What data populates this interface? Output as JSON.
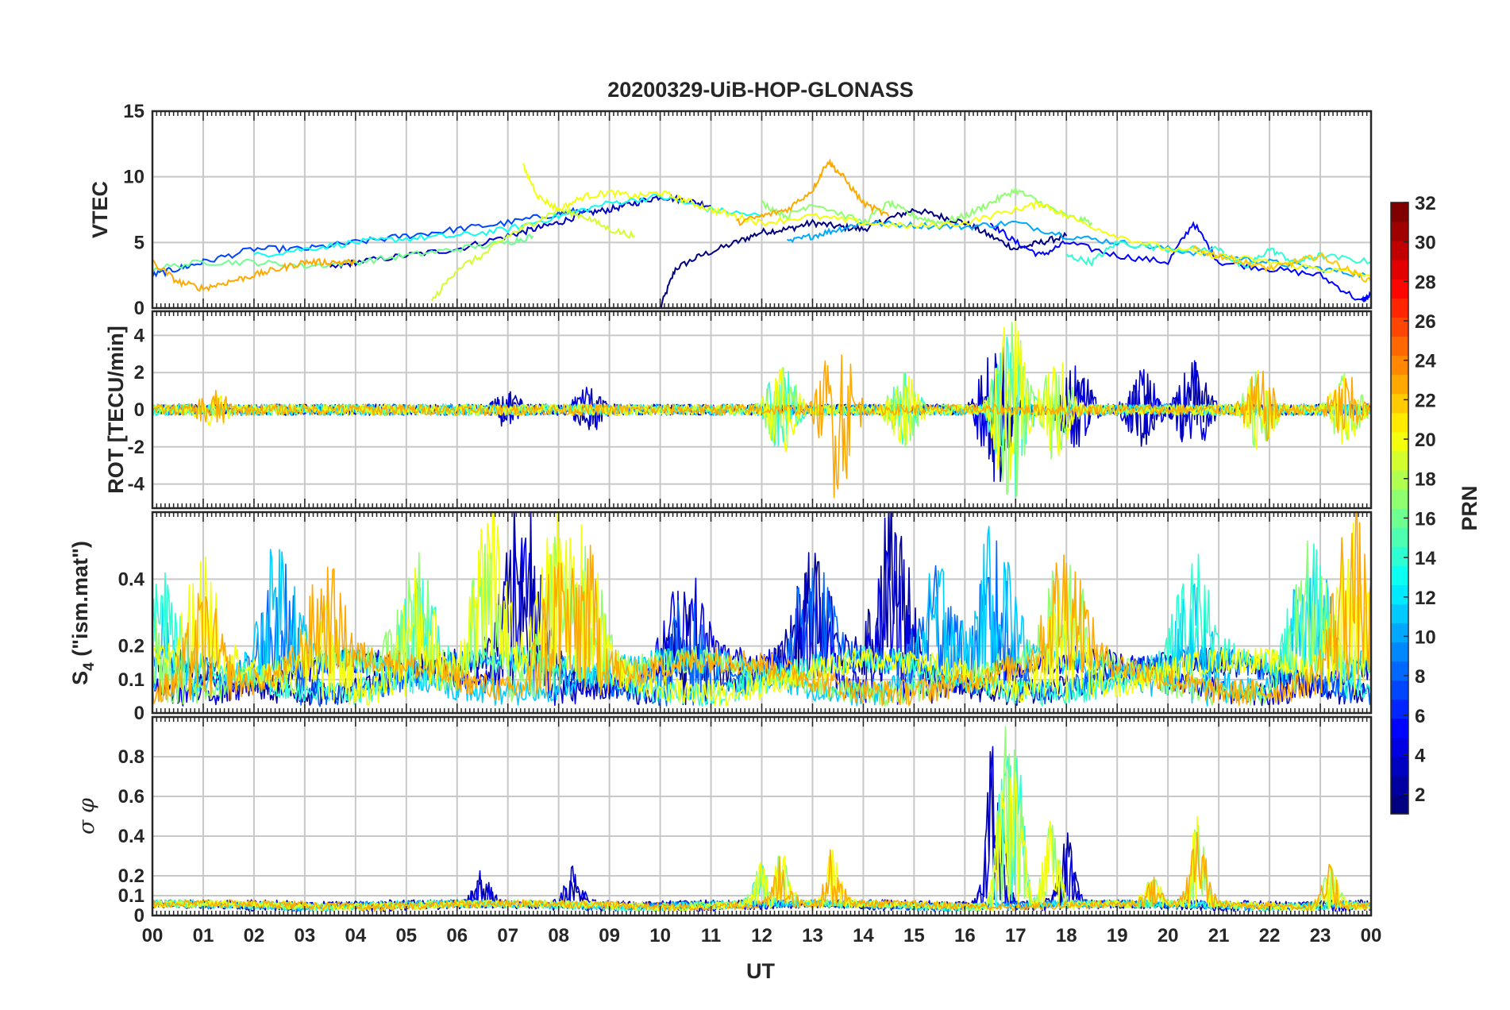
{
  "chart_data": {
    "type": "line",
    "title": "20200329-UiB-HOP-GLONASS",
    "xlabel": "UT",
    "x_ticks": [
      "00",
      "01",
      "02",
      "03",
      "04",
      "05",
      "06",
      "07",
      "08",
      "09",
      "10",
      "11",
      "12",
      "13",
      "14",
      "15",
      "16",
      "17",
      "18",
      "19",
      "20",
      "21",
      "22",
      "23",
      "00"
    ],
    "xlim_hours": [
      0,
      24
    ],
    "grid": true,
    "colorbar": {
      "label": "PRN",
      "range": [
        1,
        32
      ],
      "ticks": [
        "2",
        "4",
        "6",
        "8",
        "10",
        "12",
        "14",
        "16",
        "18",
        "20",
        "22",
        "24",
        "26",
        "28",
        "30",
        "32"
      ],
      "colormap": "jet"
    },
    "panels": [
      {
        "id": "vtec",
        "ylabel": "VTEC",
        "ylim": [
          0,
          15
        ],
        "y_ticks": [
          "0",
          "5",
          "10",
          "15"
        ],
        "series": [
          {
            "prn": 1,
            "x": [
              10.0,
              10.3,
              10.8,
              11.5,
              12.0,
              12.5,
              13.0,
              13.5,
              14.0,
              14.5,
              15.0,
              15.5,
              16.0,
              16.5,
              17.0,
              17.5,
              18.0
            ],
            "y": [
              0,
              3,
              4,
              5,
              5.8,
              6,
              6.5,
              6.2,
              6,
              6.8,
              7.5,
              7,
              6.5,
              5.5,
              4.5,
              5,
              5.5
            ]
          },
          {
            "prn": 3,
            "x": [
              3.5,
              4.0,
              5.0,
              6.0,
              7.0,
              7.5,
              8.0,
              8.5,
              9.0,
              9.5,
              10.0,
              10.5,
              11.0
            ],
            "y": [
              3,
              3.5,
              4,
              4.5,
              5.5,
              6,
              6.5,
              7.2,
              7.5,
              8,
              8.5,
              8.2,
              7.8
            ]
          },
          {
            "prn": 5,
            "x": [
              16.5,
              17.0,
              17.5,
              18.0,
              19.0,
              20.0,
              20.5,
              21.0,
              22.0,
              23.0,
              23.8,
              24.0
            ],
            "y": [
              6.5,
              5,
              4,
              5,
              4,
              3.5,
              6.5,
              3.5,
              3,
              2.5,
              0.5,
              1
            ]
          },
          {
            "prn": 7,
            "x": [
              0,
              0.5,
              1.0,
              2.0,
              3.0,
              4.0,
              5.0,
              6.0,
              7.0,
              8.0,
              8.5
            ],
            "y": [
              2.5,
              3,
              3.5,
              4.5,
              4.5,
              5,
              5.5,
              6,
              6.5,
              7.2,
              7.5
            ]
          },
          {
            "prn": 10,
            "x": [
              12.5,
              13.0,
              13.5,
              14.0,
              15.0,
              16.0,
              17.0,
              18.0,
              19.0,
              20.0,
              21.0,
              22.0,
              23.0,
              23.9
            ],
            "y": [
              5,
              5.5,
              6,
              6.5,
              6.3,
              6.2,
              6.5,
              5.5,
              5,
              4.5,
              4,
              3.5,
              3,
              2.5
            ]
          },
          {
            "prn": 13,
            "x": [
              2.0,
              3.0,
              4.0,
              5.0,
              6.0,
              7.0,
              8.0,
              9.0,
              10.0,
              11.0,
              12.0
            ],
            "y": [
              4,
              4.5,
              5,
              5.3,
              5.5,
              6,
              7,
              8,
              8.5,
              7.5,
              7
            ]
          },
          {
            "prn": 14,
            "x": [
              18.0,
              18.5,
              19.0,
              20.0,
              21.0,
              21.5,
              22.0,
              22.5,
              23.0,
              24.0
            ],
            "y": [
              4,
              3.5,
              5,
              4.5,
              4.5,
              3,
              4.5,
              3.5,
              4,
              3.5
            ]
          },
          {
            "prn": 16,
            "x": [
              0,
              1.0,
              2.0,
              3.0,
              4.0,
              5.0,
              6.0,
              7.0,
              7.5
            ],
            "y": [
              3,
              3.5,
              3.5,
              3.2,
              3.5,
              4,
              4.5,
              5,
              5.5
            ]
          },
          {
            "prn": 17,
            "x": [
              12.0,
              12.5,
              13.0,
              14.0,
              14.5,
              15.0,
              15.5,
              16.0,
              16.5,
              17.0,
              17.5,
              18.0,
              18.5
            ],
            "y": [
              8,
              7,
              8,
              6.5,
              8,
              7,
              6.5,
              7,
              8,
              9,
              8,
              7,
              6.5
            ]
          },
          {
            "prn": 19,
            "x": [
              5.5,
              6.0,
              6.5,
              7.0,
              7.5,
              8.0,
              8.5,
              9.0,
              9.5
            ],
            "y": [
              0.5,
              3,
              4,
              5.5,
              6.5,
              7.5,
              7,
              6,
              5.5
            ]
          },
          {
            "prn": 20,
            "x": [
              7.3,
              7.6,
              8.0,
              8.5,
              9.0,
              9.5,
              10.0,
              10.5,
              11.0,
              11.5,
              12.0,
              13.0,
              14.0,
              15.0,
              16.0,
              17.0,
              17.5,
              18.0,
              19.0,
              20.0,
              21.0,
              22.0,
              23.0,
              24.0
            ],
            "y": [
              10.8,
              8.5,
              7.5,
              8.5,
              8.8,
              8.5,
              8.8,
              8.2,
              7.5,
              7,
              6.5,
              7,
              6.5,
              6.2,
              6.5,
              7.5,
              8,
              7,
              5.5,
              4.5,
              4,
              3.5,
              3,
              2.5
            ]
          },
          {
            "prn": 23,
            "x": [
              0,
              0.5,
              1.0,
              1.5,
              2.0,
              2.5,
              3.0,
              3.5,
              4.0
            ],
            "y": [
              3.5,
              2,
              1.5,
              2,
              2.5,
              3,
              3.5,
              3.5,
              3.5
            ]
          },
          {
            "prn": 23,
            "x": [
              11.5,
              12.0,
              12.5,
              13.0,
              13.3,
              13.6,
              14.0,
              14.5
            ],
            "y": [
              6.5,
              7,
              7.5,
              9,
              11.2,
              10,
              8,
              7
            ]
          },
          {
            "prn": 22,
            "x": [
              20.5,
              21.0,
              21.5,
              22.0,
              22.5,
              23.0,
              23.5,
              24.0
            ],
            "y": [
              4.5,
              4,
              3.5,
              3,
              3.5,
              4,
              3,
              2
            ]
          }
        ]
      },
      {
        "id": "rot",
        "ylabel": "ROT [TECU/min]",
        "ylim": [
          -5.3,
          5.3
        ],
        "y_ticks": [
          "-4",
          "-2",
          "0",
          "2",
          "4"
        ],
        "peaks": [
          {
            "x": 1.2,
            "amp": 1.2,
            "prn": 23
          },
          {
            "x": 7.0,
            "amp": 1.0,
            "prn": 3
          },
          {
            "x": 8.6,
            "amp": 1.3,
            "prn": 2
          },
          {
            "x": 12.4,
            "amp": 2.5,
            "prn": 17
          },
          {
            "x": 13.5,
            "amp": 5.0,
            "prn": 24
          },
          {
            "x": 14.8,
            "amp": 2.0,
            "prn": 17
          },
          {
            "x": 16.6,
            "amp": 4.3,
            "prn": 2
          },
          {
            "x": 16.9,
            "amp": 5.3,
            "prn": 17
          },
          {
            "x": 17.8,
            "amp": 3.0,
            "prn": 18
          },
          {
            "x": 18.2,
            "amp": 2.5,
            "prn": 3
          },
          {
            "x": 19.5,
            "amp": 2.2,
            "prn": 3
          },
          {
            "x": 20.5,
            "amp": 2.7,
            "prn": 3
          },
          {
            "x": 21.8,
            "amp": 2.2,
            "prn": 20
          },
          {
            "x": 23.5,
            "amp": 2.0,
            "prn": 20
          }
        ]
      },
      {
        "id": "s4",
        "ylabel": "S4 (\"ism.mat\")",
        "ylabel_main": "S",
        "ylabel_sub": "4",
        "ylabel_rest": " (\"ism.mat\")",
        "ylim": [
          0,
          0.6
        ],
        "y_ticks": [
          "0",
          "0.1",
          "0.2",
          "0.4"
        ],
        "peaks": [
          {
            "x": 0.1,
            "amp": 0.35,
            "prn": 14
          },
          {
            "x": 1.0,
            "amp": 0.38,
            "prn": 23
          },
          {
            "x": 2.5,
            "amp": 0.47,
            "prn": 8
          },
          {
            "x": 3.4,
            "amp": 0.38,
            "prn": 23
          },
          {
            "x": 5.2,
            "amp": 0.42,
            "prn": 17
          },
          {
            "x": 6.6,
            "amp": 0.55,
            "prn": 19
          },
          {
            "x": 7.3,
            "amp": 0.6,
            "prn": 2
          },
          {
            "x": 8.0,
            "amp": 0.55,
            "prn": 20
          },
          {
            "x": 8.5,
            "amp": 0.52,
            "prn": 20
          },
          {
            "x": 10.5,
            "amp": 0.37,
            "prn": 5
          },
          {
            "x": 13.0,
            "amp": 0.4,
            "prn": 5
          },
          {
            "x": 14.6,
            "amp": 0.6,
            "prn": 4
          },
          {
            "x": 15.5,
            "amp": 0.45,
            "prn": 8
          },
          {
            "x": 16.6,
            "amp": 0.52,
            "prn": 10
          },
          {
            "x": 18.0,
            "amp": 0.45,
            "prn": 20
          },
          {
            "x": 20.5,
            "amp": 0.4,
            "prn": 13
          },
          {
            "x": 22.8,
            "amp": 0.5,
            "prn": 14
          },
          {
            "x": 23.6,
            "amp": 0.58,
            "prn": 23
          }
        ]
      },
      {
        "id": "sigma_phi",
        "ylabel": "σ φ",
        "ylim": [
          0,
          1.0
        ],
        "y_ticks": [
          "0",
          "0.1",
          "0.2",
          "0.4",
          "0.6",
          "0.8"
        ],
        "peaks": [
          {
            "x": 6.5,
            "amp": 0.18,
            "prn": 2
          },
          {
            "x": 8.3,
            "amp": 0.19,
            "prn": 3
          },
          {
            "x": 12.0,
            "amp": 0.2,
            "prn": 17
          },
          {
            "x": 12.4,
            "amp": 0.26,
            "prn": 20
          },
          {
            "x": 13.4,
            "amp": 0.27,
            "prn": 23
          },
          {
            "x": 16.6,
            "amp": 0.98,
            "prn": 2
          },
          {
            "x": 16.8,
            "amp": 0.9,
            "prn": 17
          },
          {
            "x": 17.0,
            "amp": 0.82,
            "prn": 17
          },
          {
            "x": 17.7,
            "amp": 0.43,
            "prn": 18
          },
          {
            "x": 18.0,
            "amp": 0.35,
            "prn": 2
          },
          {
            "x": 19.7,
            "amp": 0.12,
            "prn": 20
          },
          {
            "x": 20.6,
            "amp": 0.44,
            "prn": 20
          },
          {
            "x": 23.2,
            "amp": 0.2,
            "prn": 20
          }
        ]
      }
    ]
  }
}
